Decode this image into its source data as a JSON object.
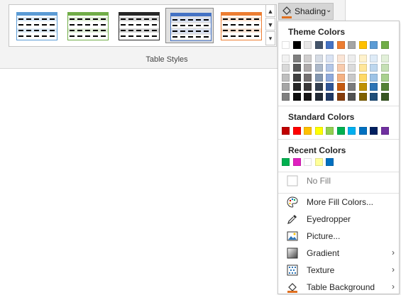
{
  "ribbon": {
    "group_label": "Table Styles",
    "shading_label": "Shading",
    "styles": [
      {
        "name": "blue",
        "color": "#5b9bd5",
        "light": "#deebf7"
      },
      {
        "name": "green",
        "color": "#70ad47",
        "light": "#e2efda"
      },
      {
        "name": "black",
        "color": "#262626",
        "light": "#d9d9d9"
      },
      {
        "name": "blue-selected",
        "color": "#4472c4",
        "light": "#d9e1f2"
      },
      {
        "name": "orange",
        "color": "#ed7d31",
        "light": "#fbe5d6"
      }
    ]
  },
  "menu": {
    "theme_title": "Theme Colors",
    "standard_title": "Standard Colors",
    "recent_title": "Recent Colors",
    "theme_colors": [
      [
        "#ffffff",
        "#f2f2f2",
        "#d9d9d9",
        "#bfbfbf",
        "#a6a6a6",
        "#808080"
      ],
      [
        "#000000",
        "#7f7f7f",
        "#595959",
        "#404040",
        "#262626",
        "#0d0d0d"
      ],
      [
        "#e7e6e6",
        "#d0cece",
        "#aeaaaa",
        "#757171",
        "#3a3838",
        "#171616"
      ],
      [
        "#44546a",
        "#d6dce5",
        "#adb9ca",
        "#8497b0",
        "#333f50",
        "#222a35"
      ],
      [
        "#4472c4",
        "#dae3f3",
        "#b4c7e7",
        "#8faadc",
        "#2f5597",
        "#1f3864"
      ],
      [
        "#ed7d31",
        "#fbe5d6",
        "#f8cbad",
        "#f4b183",
        "#c55a11",
        "#843c0c"
      ],
      [
        "#a5a5a5",
        "#ededed",
        "#dbdbdb",
        "#c9c9c9",
        "#7b7b7b",
        "#525252"
      ],
      [
        "#ffc000",
        "#fff2cc",
        "#ffe699",
        "#ffd966",
        "#bf9000",
        "#7f6000"
      ],
      [
        "#5b9bd5",
        "#deebf7",
        "#bdd7ee",
        "#9dc3e6",
        "#2e75b6",
        "#1f4e79"
      ],
      [
        "#70ad47",
        "#e2f0d9",
        "#c5e0b4",
        "#a9d18e",
        "#548235",
        "#385723"
      ]
    ],
    "standard_colors": [
      "#c00000",
      "#ff0000",
      "#ffc000",
      "#ffff00",
      "#92d050",
      "#00b050",
      "#00b0f0",
      "#0070c0",
      "#002060",
      "#7030a0"
    ],
    "recent_colors": [
      "#00b050",
      "#e020c0",
      "#ffffff",
      "#ffff99",
      "#0070c0"
    ],
    "items": [
      {
        "id": "no-fill",
        "label": "No Fill",
        "icon": "no-fill-icon",
        "disabled": true,
        "arrow": false
      },
      {
        "id": "more-fill-colors",
        "label": "More Fill Colors...",
        "icon": "palette-icon",
        "disabled": false,
        "arrow": false
      },
      {
        "id": "eyedropper",
        "label": "Eyedropper",
        "icon": "eyedropper-icon",
        "disabled": false,
        "arrow": false
      },
      {
        "id": "picture",
        "label": "Picture...",
        "icon": "picture-icon",
        "disabled": false,
        "arrow": false
      },
      {
        "id": "gradient",
        "label": "Gradient",
        "icon": "gradient-icon",
        "disabled": false,
        "arrow": true
      },
      {
        "id": "texture",
        "label": "Texture",
        "icon": "texture-icon",
        "disabled": false,
        "arrow": true
      },
      {
        "id": "table-background",
        "label": "Table Background",
        "icon": "table-background-icon",
        "disabled": false,
        "arrow": true
      }
    ]
  }
}
